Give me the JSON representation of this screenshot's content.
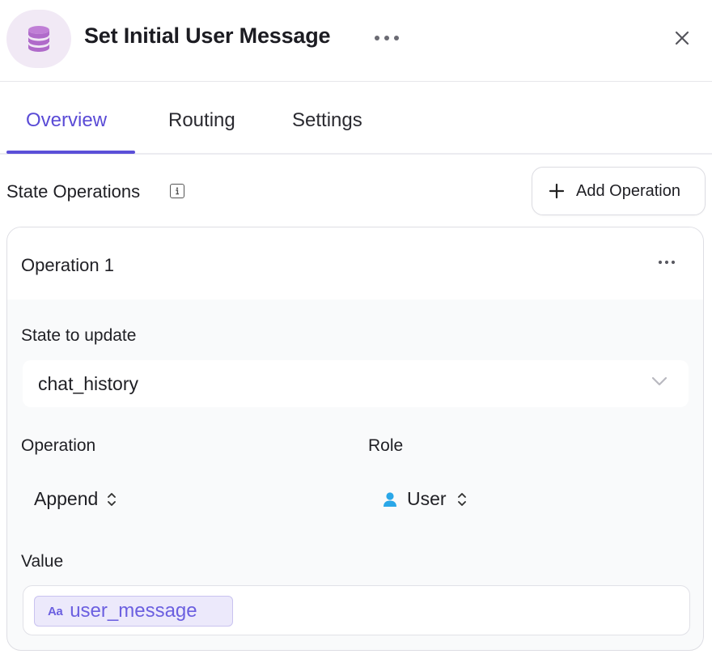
{
  "header": {
    "node_icon": "database-icon",
    "title": "Set Initial User Message",
    "more_icon": "ellipsis-horizontal-icon",
    "close_icon": "close-icon"
  },
  "tabs": [
    {
      "label": "Overview",
      "active": true
    },
    {
      "label": "Routing",
      "active": false
    },
    {
      "label": "Settings",
      "active": false
    }
  ],
  "state_operations": {
    "label": "State Operations",
    "info_icon": "info-icon",
    "add_button_label": "Add Operation",
    "add_icon": "plus-icon"
  },
  "operation": {
    "title": "Operation 1",
    "state_label": "State to update",
    "state_value": "chat_history",
    "operation_label": "Operation",
    "operation_value": "Append",
    "role_label": "Role",
    "role_value": "User",
    "role_icon": "user-icon",
    "value_label": "Value",
    "value_chip": "user_message",
    "value_chip_icon": "text-type-icon",
    "value_chip_icon_text": "Aa"
  },
  "colors": {
    "accent": "#5b4fd8",
    "node_icon_bg": "#f1e9f5",
    "node_icon": "#b86fd0",
    "user_icon": "#2aa7e8"
  }
}
